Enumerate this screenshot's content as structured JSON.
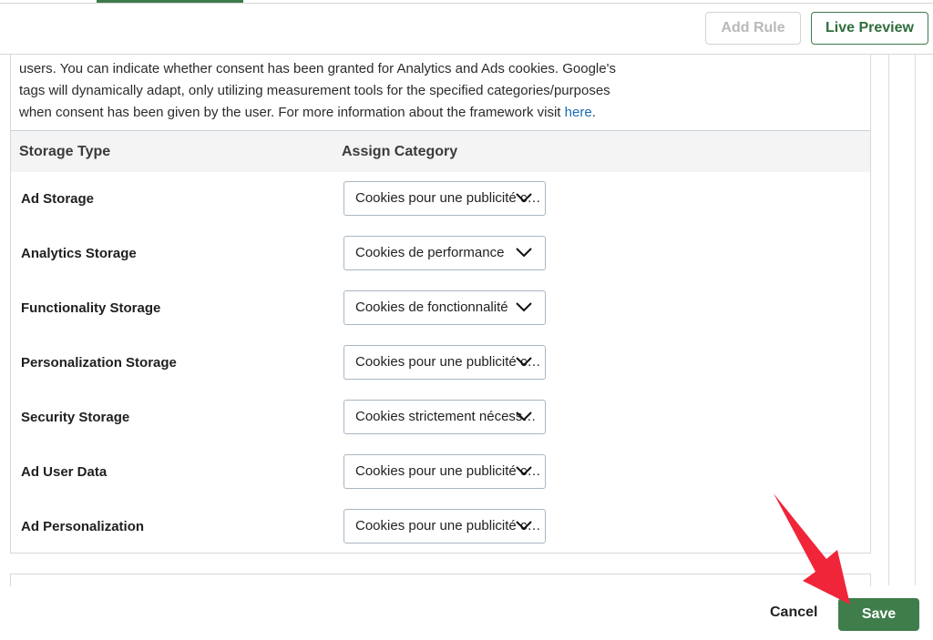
{
  "toolbar": {
    "add_rule_label": "Add Rule",
    "live_preview_label": "Live Preview"
  },
  "description": {
    "line1": "users. You can indicate whether consent has been granted for Analytics and Ads cookies. Google's",
    "line2": "tags will dynamically adapt, only utilizing measurement tools for the specified categories/purposes",
    "line3_prefix": "when consent has been given by the user. For more information about the framework visit ",
    "link_text": "here",
    "line3_suffix": "."
  },
  "table": {
    "headers": [
      "Storage Type",
      "Assign Category"
    ],
    "rows": [
      {
        "storage_type": "Ad Storage",
        "category": "Cookies pour une publicité ciblée"
      },
      {
        "storage_type": "Analytics Storage",
        "category": "Cookies de performance"
      },
      {
        "storage_type": "Functionality Storage",
        "category": "Cookies de fonctionnalité"
      },
      {
        "storage_type": "Personalization Storage",
        "category": "Cookies pour une publicité ciblée"
      },
      {
        "storage_type": "Security Storage",
        "category": "Cookies strictement nécessaires"
      },
      {
        "storage_type": "Ad User Data",
        "category": "Cookies pour une publicité ciblée"
      },
      {
        "storage_type": "Ad Personalization",
        "category": "Cookies pour une publicité ciblée"
      }
    ]
  },
  "footer": {
    "cancel_label": "Cancel",
    "save_label": "Save"
  },
  "colors": {
    "accent_green": "#3f7d4b",
    "link_blue": "#1b6cb5",
    "annotation_red": "#f0253a"
  }
}
